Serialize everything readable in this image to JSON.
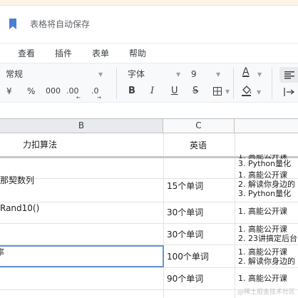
{
  "header": {
    "doc_title": "表格将自动保存"
  },
  "menu": {
    "items": [
      "查看",
      "插件",
      "表单",
      "帮助"
    ]
  },
  "toolbar": {
    "number_format": "常规",
    "currency_symbol": "¥",
    "percent_symbol": "%",
    "thousands_label": "000",
    "decimal_increase_label": ".00",
    "decimal_decrease_label": ".0",
    "font_family": "字体",
    "font_size": "9",
    "bold_label": "B",
    "italic_label": "I",
    "underline_label": "U",
    "strike_label": "S",
    "text_color_label": "A",
    "text_color": "#202124"
  },
  "columns": {
    "B_letter": "B",
    "C_letter": "C"
  },
  "table": {
    "header": {
      "B": "力扣算法",
      "C": "英语"
    },
    "rows": [
      {
        "B": "",
        "C": "",
        "D": [
          "3. Python量化"
        ]
      },
      {
        "B": "那契数列",
        "C": "15个单词",
        "D": [
          "1. 高能公开课",
          "2. 解读你身边的",
          "3. Python量化"
        ]
      },
      {
        "B": "Rand10()",
        "C": "30个单词",
        "D": [
          "1. 高能公开课"
        ]
      },
      {
        "B": "",
        "C": "30个单词",
        "D": [
          "1. 高能公开课",
          "2. 23讲搞定后台"
        ]
      },
      {
        "B": "",
        "C": "100个单词",
        "D": [
          "1. 高能公开课",
          "2. 解读你身边的"
        ]
      },
      {
        "B": "",
        "C": "90个单词",
        "D": [
          "1. 高能公开课"
        ]
      }
    ]
  },
  "watermark": "@稀土掘金技术社区",
  "colors": {
    "accent_blue": "#4a7fd6",
    "selection_border": "#6a93d6",
    "notice_bar": "#fdf6e7"
  }
}
